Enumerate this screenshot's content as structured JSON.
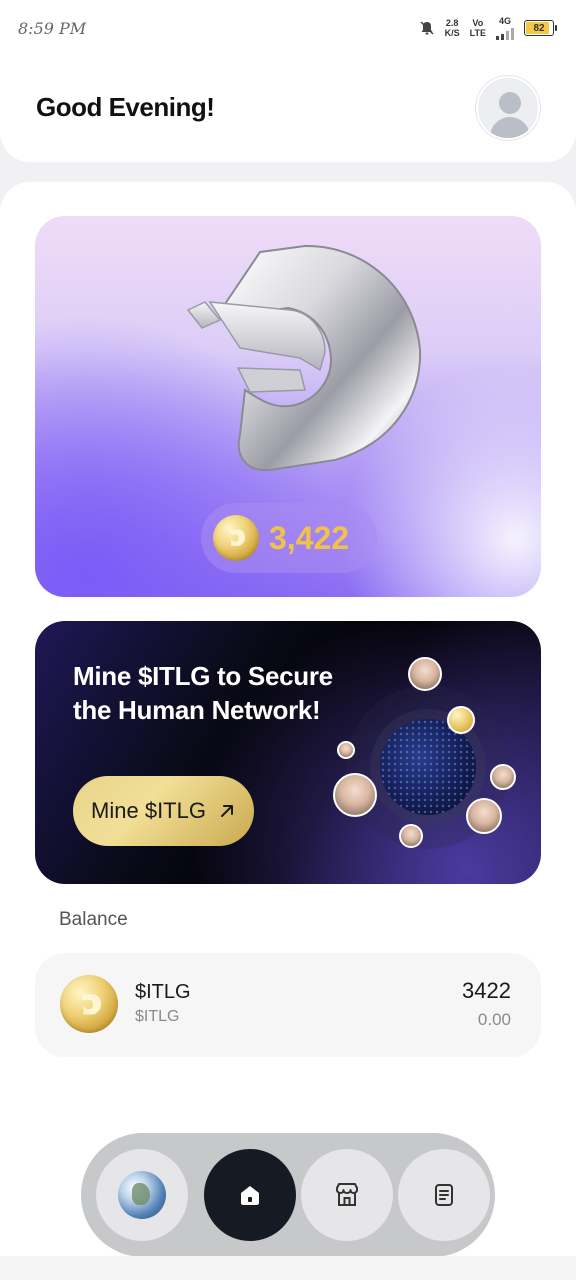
{
  "status_bar": {
    "time": "8:59 PM",
    "net_speed": "2.8",
    "net_speed_unit": "K/S",
    "vo": "Vo",
    "lte": "LTE",
    "network": "4G",
    "battery": "82"
  },
  "header": {
    "greeting": "Good Evening!"
  },
  "hero": {
    "points": "3,422"
  },
  "promo": {
    "title": "Mine $ITLG to Secure the Human Network!",
    "button_label": "Mine $ITLG"
  },
  "balance": {
    "label": "Balance",
    "token_name": "$ITLG",
    "token_symbol": "$ITLG",
    "amount": "3422",
    "value": "0.00"
  },
  "colors": {
    "accent_purple": "#8b6cf4",
    "gold": "#f0c24a",
    "nav_active": "#161a22"
  },
  "nav": {
    "items": [
      "globe-icon",
      "home-icon",
      "store-icon",
      "notebook-icon"
    ],
    "active": "home-icon"
  }
}
